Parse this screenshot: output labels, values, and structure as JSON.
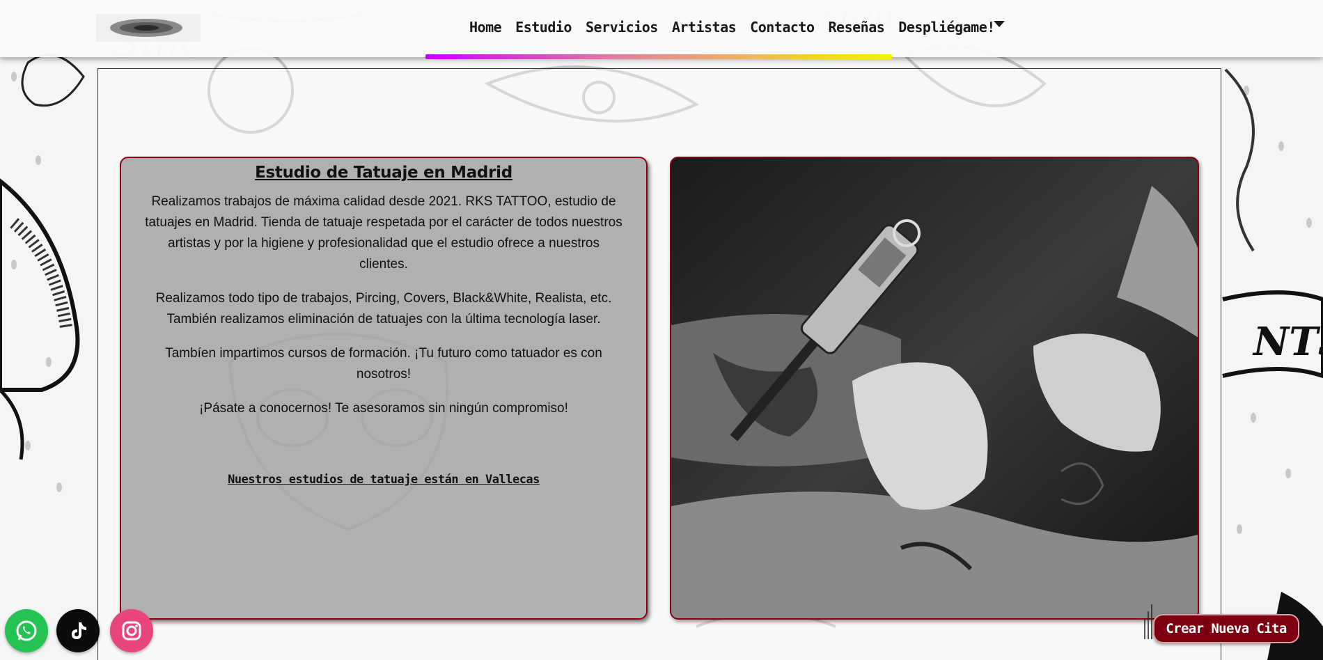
{
  "nav": {
    "items": [
      {
        "label": "Home"
      },
      {
        "label": "Estudio"
      },
      {
        "label": "Servicios"
      },
      {
        "label": "Artistas"
      },
      {
        "label": "Contacto"
      },
      {
        "label": "Reseñas"
      },
      {
        "label": "Despliégame!"
      }
    ],
    "underline_colors": [
      "#c800ff",
      "#e37ba0",
      "#f3b65a",
      "#f7f200"
    ]
  },
  "studio": {
    "title": "Estudio de Tatuaje en Madrid",
    "paragraphs": [
      "Realizamos trabajos de máxima calidad desde 2021. RKS TATTOO, estudio de tatuajes en Madrid. Tienda de tatuaje respetada por el carácter de todos nuestros artistas y por la higiene y profesionalidad que el estudio ofrece a nuestros clientes.",
      "Realizamos todo tipo de trabajos, Pircing, Covers, Black&White, Realista, etc. También realizamos eliminación de tatuajes con la última tecnología laser.",
      "Tambíen impartimos cursos de formación. ¡Tu futuro como tatuador es con nosotros!",
      "¡Pásate a conocernos! Te asesoramos sin ningún compromiso!"
    ],
    "location_link": "Nuestros estudios de tatuaje están en Vallecas"
  },
  "social": {
    "whatsapp": {
      "icon": "whatsapp-icon",
      "color": "#25c353"
    },
    "tiktok": {
      "icon": "tiktok-icon",
      "color": "#0b0b0b"
    },
    "instagram": {
      "icon": "instagram-icon",
      "color": "#e8457c"
    }
  },
  "cta": {
    "label": "Crear Nueva Cita",
    "color": "#7d0010"
  }
}
